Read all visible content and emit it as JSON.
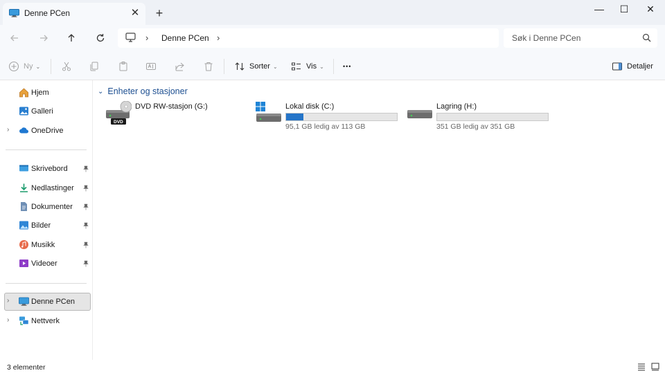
{
  "window": {
    "tab_title": "Denne PCen",
    "tab_close_glyph": "✕",
    "new_tab_glyph": "+",
    "minimize_glyph": "—",
    "maximize_glyph": "☐",
    "close_glyph": "✕"
  },
  "address": {
    "crumb": "Denne PCen",
    "search_placeholder": "Søk i Denne PCen"
  },
  "commands": {
    "new_label": "Ny",
    "sort_label": "Sorter",
    "view_label": "Vis",
    "more_glyph": "•••",
    "details_label": "Detaljer"
  },
  "sidebar": {
    "quick": [
      {
        "label": "Hjem",
        "icon": "home-icon"
      },
      {
        "label": "Galleri",
        "icon": "gallery-icon"
      },
      {
        "label": "OneDrive",
        "icon": "cloud-icon"
      }
    ],
    "pinned": [
      {
        "label": "Skrivebord",
        "icon": "desktop-icon"
      },
      {
        "label": "Nedlastinger",
        "icon": "download-icon"
      },
      {
        "label": "Dokumenter",
        "icon": "documents-icon"
      },
      {
        "label": "Bilder",
        "icon": "pictures-icon"
      },
      {
        "label": "Musikk",
        "icon": "music-icon"
      },
      {
        "label": "Videoer",
        "icon": "videos-icon"
      }
    ],
    "locations": [
      {
        "label": "Denne PCen",
        "icon": "computer-icon",
        "selected": true
      },
      {
        "label": "Nettverk",
        "icon": "network-icon"
      }
    ]
  },
  "main": {
    "group_title": "Enheter og stasjoner",
    "drives": [
      {
        "name": "DVD RW-stasjon (G:)",
        "icon": "dvd-drive-icon",
        "badge": "DVD"
      },
      {
        "name": "Lokal disk (C:)",
        "icon": "system-disk-icon",
        "free_text": "95,1 GB ledig av 113 GB",
        "used_fraction": 0.158
      },
      {
        "name": "Lagring (H:)",
        "icon": "hard-disk-icon",
        "free_text": "351 GB ledig av 351 GB",
        "used_fraction": 0.0
      }
    ]
  },
  "status": {
    "count_text": "3 elementer"
  },
  "colors": {
    "accent": "#2675c8",
    "group_header": "#1d4f91",
    "chrome": "#eef1f6"
  }
}
